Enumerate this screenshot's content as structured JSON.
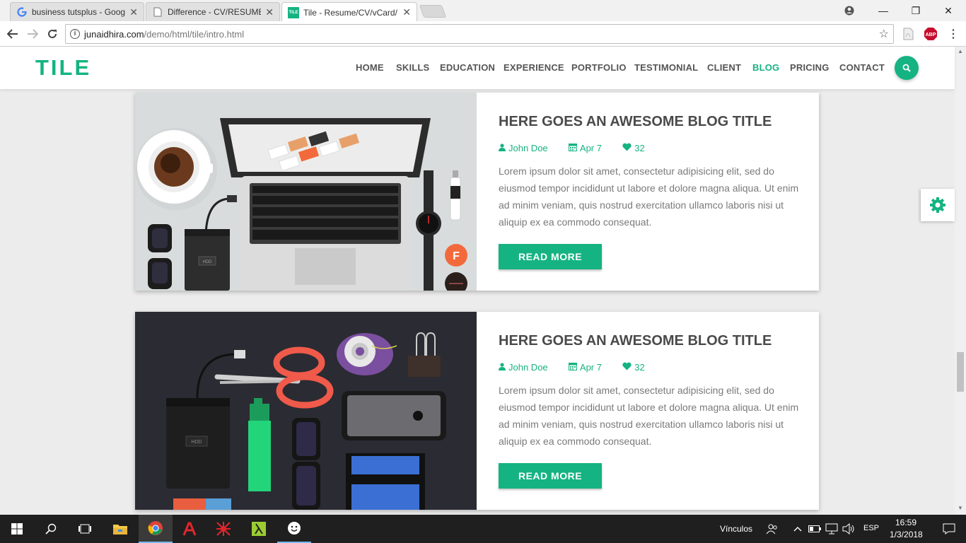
{
  "browser": {
    "tabs": [
      {
        "title": "business tutsplus - Goog",
        "icon": "google-g-icon"
      },
      {
        "title": "Difference - CV/RESUME",
        "icon": "document-icon"
      },
      {
        "title": "Tile - Resume/CV/vCard/",
        "icon": "tile-favicon",
        "active": true
      }
    ],
    "favicon_text": "TILE",
    "url_host": "junaidhira.com",
    "url_path": "/demo/html/tile/intro.html",
    "extension_abp": "ABP"
  },
  "site": {
    "logo": "TILE",
    "nav": [
      "HOME",
      "SKILLS",
      "EDUCATION",
      "EXPERIENCE",
      "PORTFOLIO",
      "TESTIMONIAL",
      "CLIENT",
      "BLOG",
      "PRICING",
      "CONTACT"
    ],
    "active_nav": "BLOG",
    "accent": "#15b381"
  },
  "posts": [
    {
      "title": "HERE GOES AN AWESOME BLOG TITLE",
      "author": "John Doe",
      "date": "Apr 7",
      "likes": "32",
      "excerpt": "Lorem ipsum dolor sit amet, consectetur adipisicing elit, sed do eiusmod tempor incididunt ut labore et dolore magna aliqua. Ut enim ad minim veniam, quis nostrud exercitation ullamco laboris nisi ut aliquip ex ea commodo consequat.",
      "button": "READ MORE",
      "image_labels": {
        "hdd": "HDD",
        "badge": "F"
      }
    },
    {
      "title": "HERE GOES AN AWESOME BLOG TITLE",
      "author": "John Doe",
      "date": "Apr 7",
      "likes": "32",
      "excerpt": "Lorem ipsum dolor sit amet, consectetur adipisicing elit, sed do eiusmod tempor incididunt ut labore et dolore magna aliqua. Ut enim ad minim veniam, quis nostrud exercitation ullamco laboris nisi ut aliquip ex ea commodo consequat.",
      "button": "READ MORE",
      "image_labels": {
        "hdd": "HDD"
      }
    }
  ],
  "taskbar": {
    "links_label": "Vínculos",
    "lang": "ESP",
    "time": "16:59",
    "date": "1/3/2018"
  }
}
